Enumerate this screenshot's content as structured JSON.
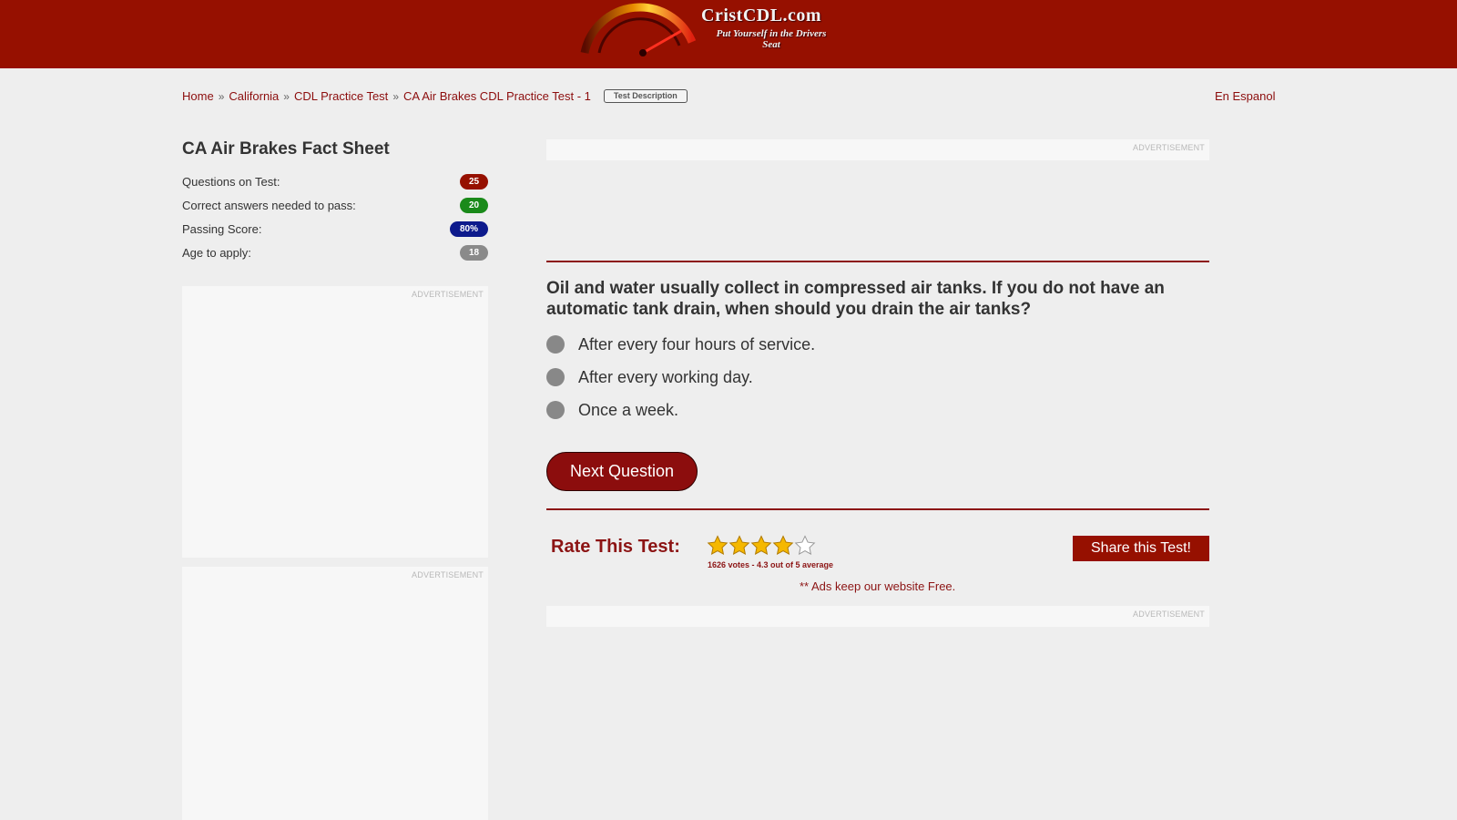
{
  "header": {
    "logo_title": "CristCDL.com",
    "logo_tagline": "Put Yourself in the Drivers Seat",
    "bg_color": "#961000"
  },
  "breadcrumb": {
    "items": [
      "Home",
      "California",
      "CDL Practice Test",
      "CA Air Brakes CDL Practice Test - 1"
    ],
    "separator": "»",
    "test_description_label": "Test Description",
    "language_link": "En Espanol"
  },
  "fact_sheet": {
    "title": "CA Air Brakes Fact Sheet",
    "rows": [
      {
        "label": "Questions on Test:",
        "value": "25",
        "color": "#961000"
      },
      {
        "label": "Correct answers needed to pass:",
        "value": "20",
        "color": "#1a8a1a"
      },
      {
        "label": "Passing Score:",
        "value": "80%",
        "color": "#0d1a8c"
      },
      {
        "label": "Age to apply:",
        "value": "18",
        "color": "#8a8a8a"
      }
    ]
  },
  "ads": {
    "label": "ADVERTISEMENT"
  },
  "quiz": {
    "question": "Oil and water usually collect in compressed air tanks. If you do not have an automatic tank drain, when should you drain the air tanks?",
    "answers": [
      "After every four hours of service.",
      "After every working day.",
      "Once a week."
    ],
    "next_label": "Next Question"
  },
  "rating": {
    "label": "Rate This Test:",
    "stars_filled": 4,
    "stars_total": 5,
    "votes_text": "1626 votes - 4.3 out of 5 average",
    "share_label": "Share this Test!",
    "ads_note": "** Ads keep our website Free."
  }
}
